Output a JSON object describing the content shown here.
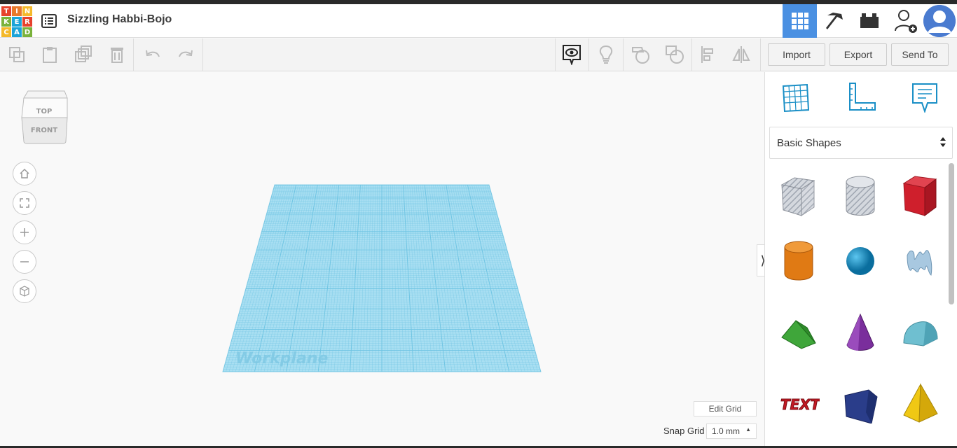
{
  "app": {
    "logo_letters": [
      "T",
      "I",
      "N",
      "K",
      "E",
      "R",
      "C",
      "A",
      "D"
    ],
    "logo_colors": [
      "#e6422d",
      "#e8792b",
      "#f4b92b",
      "#7ab23b",
      "#1ba4d8",
      "#e6422d",
      "#f4b92b",
      "#1ba4d8",
      "#7ab23b"
    ],
    "design_title": "Sizzling Habbi-Bojo"
  },
  "toolbar": {
    "import_label": "Import",
    "export_label": "Export",
    "send_to_label": "Send To"
  },
  "viewport": {
    "viewcube_top": "TOP",
    "viewcube_front": "FRONT",
    "workplane_label": "Workplane",
    "edit_grid_label": "Edit Grid",
    "snap_grid_label": "Snap Grid",
    "snap_grid_value": "1.0 mm"
  },
  "shapes_panel": {
    "category": "Basic Shapes",
    "shapes": [
      "box-hole",
      "cylinder-hole",
      "box",
      "cylinder",
      "sphere",
      "scribble",
      "roof",
      "cone",
      "round-roof",
      "text",
      "wedge",
      "pyramid"
    ]
  },
  "colors": {
    "accent": "#4a90e2",
    "workplane": "#a9dff2",
    "workplane_lines": "#6cc3e2"
  }
}
